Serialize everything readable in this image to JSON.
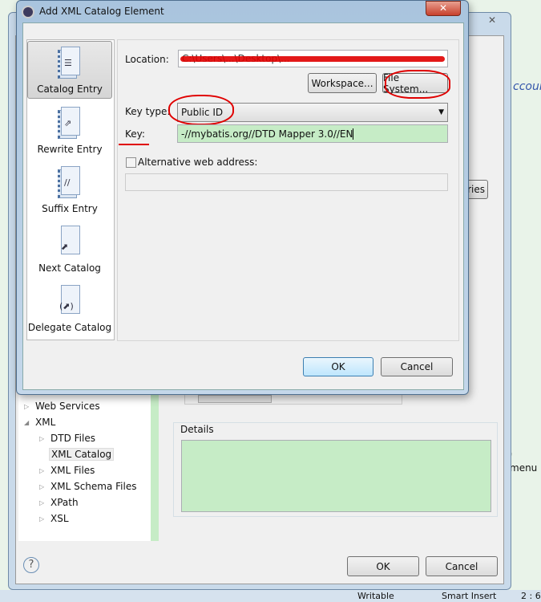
{
  "dialog": {
    "title": "Add XML Catalog Element",
    "close_icon": "close-icon",
    "sidebar": [
      {
        "label": "Catalog Entry",
        "icon": "catalog-entry-icon",
        "selected": true
      },
      {
        "label": "Rewrite Entry",
        "icon": "rewrite-entry-icon"
      },
      {
        "label": "Suffix Entry",
        "icon": "suffix-entry-icon"
      },
      {
        "label": "Next Catalog",
        "icon": "next-catalog-icon"
      },
      {
        "label": "Delegate Catalog",
        "icon": "delegate-catalog-icon"
      }
    ],
    "location_label": "Location:",
    "location_value": "C:\\Users\\...\\Desktop\\...",
    "workspace_button": "Workspace...",
    "file_system_button": "File System...",
    "key_type_label": "Key type:",
    "key_type_value": "Public ID",
    "key_label": "Key:",
    "key_value": "-//mybatis.org//DTD Mapper 3.0//EN",
    "alt_web_label": "Alternative web address:",
    "alt_web_checked": false,
    "ok": "OK",
    "cancel": "Cancel",
    "annotation_color": "#e00000"
  },
  "preferences": {
    "tree": [
      {
        "label": "Web Services",
        "expanded": false,
        "level": 0
      },
      {
        "label": "XML",
        "expanded": true,
        "level": 0
      },
      {
        "label": "DTD Files",
        "level": 1
      },
      {
        "label": "XML Catalog",
        "level": 1,
        "selected": true
      },
      {
        "label": "XML Files",
        "level": 1
      },
      {
        "label": "XML Schema Files",
        "level": 1
      },
      {
        "label": "XPath",
        "level": 1
      },
      {
        "label": "XSL",
        "level": 1
      }
    ],
    "details_label": "Details",
    "partial_button": "ries",
    "ok": "OK",
    "cancel": "Cancel",
    "help_icon": "help-icon"
  },
  "background": {
    "right_text_1": "ccoun",
    "right_text_2": "' menu",
    "status": [
      "Writable",
      "Smart Insert",
      "2 : 6"
    ]
  }
}
